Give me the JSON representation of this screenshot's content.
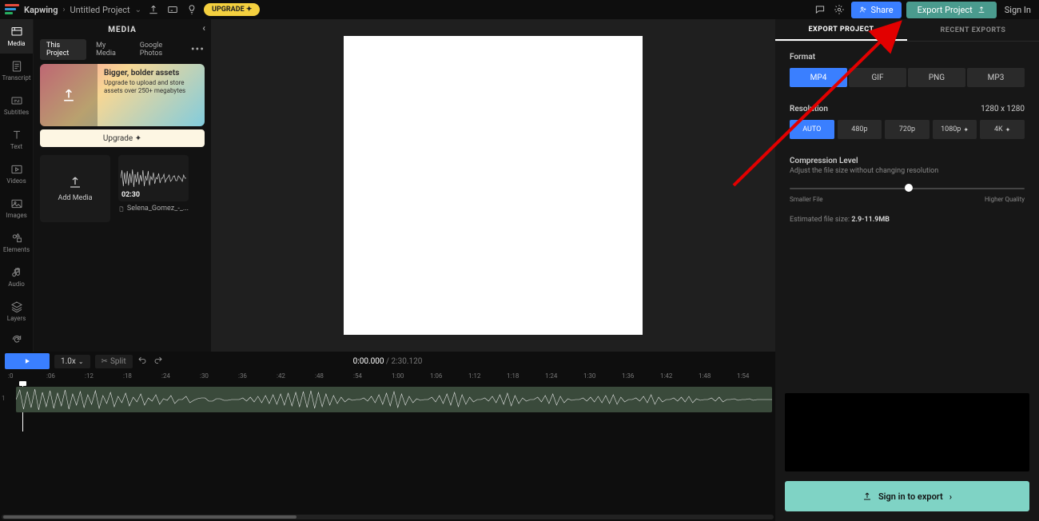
{
  "header": {
    "brand": "Kapwing",
    "project": "Untitled Project",
    "upgrade_pill": "UPGRADE ✦",
    "share": "Share",
    "export": "Export Project",
    "signin": "Sign In"
  },
  "rail": {
    "media": "Media",
    "transcript": "Transcript",
    "subtitles": "Subtitles",
    "text": "Text",
    "videos": "Videos",
    "images": "Images",
    "elements": "Elements",
    "audio": "Audio",
    "layers": "Layers"
  },
  "media": {
    "title": "MEDIA",
    "tabs": {
      "this_project": "This Project",
      "my_media": "My Media",
      "google_photos": "Google Photos"
    },
    "promo": {
      "title": "Bigger, bolder assets",
      "sub": "Upgrade to upload and store assets over 250+ megabytes",
      "btn": "Upgrade ✦"
    },
    "add_media": "Add Media",
    "clip": {
      "duration": "02:30",
      "name": "Selena_Gomez_-_..."
    }
  },
  "export": {
    "tab_export": "EXPORT PROJECT",
    "tab_recent": "RECENT EXPORTS",
    "format_label": "Format",
    "formats": {
      "mp4": "MP4",
      "gif": "GIF",
      "png": "PNG",
      "mp3": "MP3"
    },
    "res_label": "Resolution",
    "res_dim": "1280 x 1280",
    "res": {
      "auto": "AUTO",
      "r480": "480p",
      "r720": "720p",
      "r1080": "1080p",
      "r4k": "4K"
    },
    "comp_label": "Compression Level",
    "comp_sub": "Adjust the file size without changing resolution",
    "slider": {
      "left": "Smaller File",
      "right": "Higher Quality",
      "pos_pct": 49
    },
    "est_prefix": "Estimated file size: ",
    "est_value": "2.9-11.9MB",
    "signin_export": "Sign in to export"
  },
  "timeline": {
    "speed": "1.0x",
    "split": "Split",
    "time_current": "0:00.000",
    "time_total": "2:30.120",
    "ruler": [
      ":0",
      ":06",
      ":12",
      ":18",
      ":24",
      ":30",
      ":36",
      ":42",
      ":48",
      ":54",
      "1:00",
      "1:06",
      "1:12",
      "1:18",
      "1:24",
      "1:30",
      "1:36",
      "1:42",
      "1:48",
      "1:54"
    ],
    "row_num": "1"
  }
}
